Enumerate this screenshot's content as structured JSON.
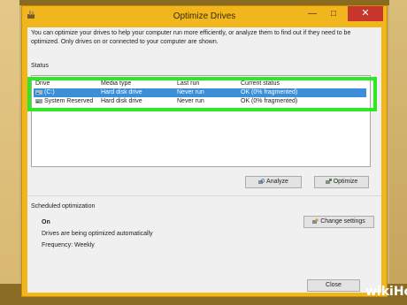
{
  "window": {
    "title": "Optimize Drives",
    "minimize_glyph": "—",
    "maximize_glyph": "□",
    "close_glyph": "✕"
  },
  "description": "You can optimize your drives to help your computer run more efficiently, or analyze them to find out if they need to be optimized. Only drives on or connected to your computer are shown.",
  "status": {
    "label": "Status",
    "columns": [
      "Drive",
      "Media type",
      "Last run",
      "Current status"
    ],
    "rows": [
      {
        "drive": "(C:)",
        "media_type": "Hard disk drive",
        "last_run": "Never run",
        "current_status": "OK (0% fragmented)",
        "selected": true
      },
      {
        "drive": "System Reserved",
        "media_type": "Hard disk drive",
        "last_run": "Never run",
        "current_status": "OK (0% fragmented)",
        "selected": false
      }
    ]
  },
  "buttons": {
    "analyze": "Analyze",
    "optimize": "Optimize",
    "change_settings": "Change settings",
    "close": "Close"
  },
  "scheduled": {
    "title": "Scheduled optimization",
    "state": "On",
    "detail": "Drives are being optimized automatically",
    "frequency": "Frequency: Weekly"
  },
  "watermark": "wikiHow",
  "colors": {
    "frame": "#f1b61d",
    "selection": "#3a8fd8",
    "highlight": "#2ee823",
    "close_button": "#c7362d"
  }
}
